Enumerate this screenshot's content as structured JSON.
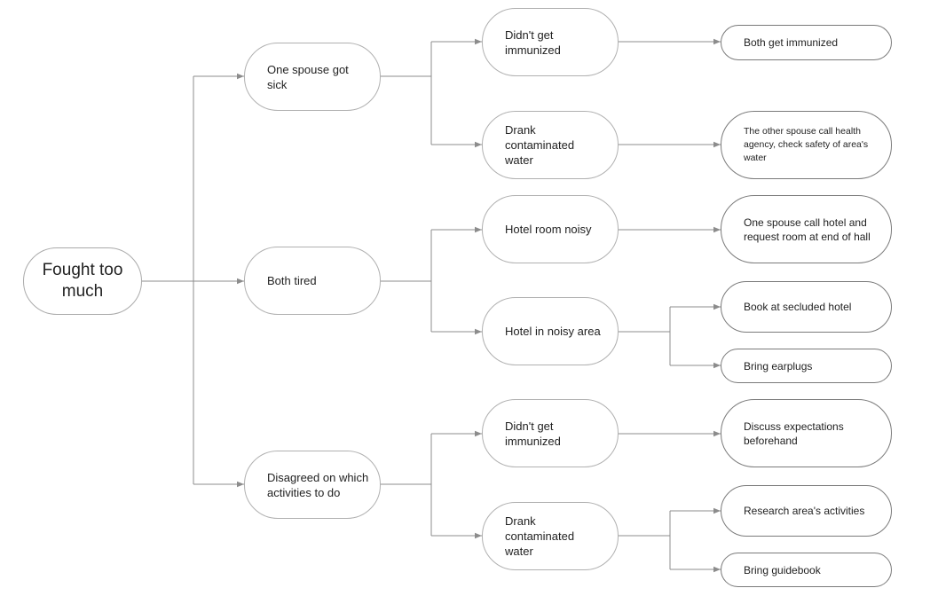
{
  "diagram": {
    "type": "cause-and-effect tree",
    "root": {
      "label": "Fought too much"
    },
    "causes": [
      {
        "label": "One spouse got sick",
        "subcauses": [
          {
            "label": "Didn't get immunized",
            "solutions": [
              "Both get immunized"
            ]
          },
          {
            "label": "Drank contaminated water",
            "solutions": [
              "The other spouse call health agency, check safety of area's water"
            ]
          }
        ]
      },
      {
        "label": "Both tired",
        "subcauses": [
          {
            "label": "Hotel room noisy",
            "solutions": [
              "One spouse call hotel and request room at end of hall"
            ]
          },
          {
            "label": "Hotel in noisy area",
            "solutions": [
              "Book at secluded hotel",
              "Bring earplugs"
            ]
          }
        ]
      },
      {
        "label": "Disagreed on which activities to do",
        "subcauses": [
          {
            "label": "Didn't get immunized",
            "solutions": [
              "Discuss expectations beforehand"
            ]
          },
          {
            "label": "Drank contaminated water",
            "solutions": [
              "Research area's activities",
              "Bring guidebook"
            ]
          }
        ]
      }
    ],
    "colors": {
      "line": "#8c8c8c",
      "node_border": "#9a9a9a",
      "text": "#222222",
      "background": "#ffffff"
    }
  }
}
